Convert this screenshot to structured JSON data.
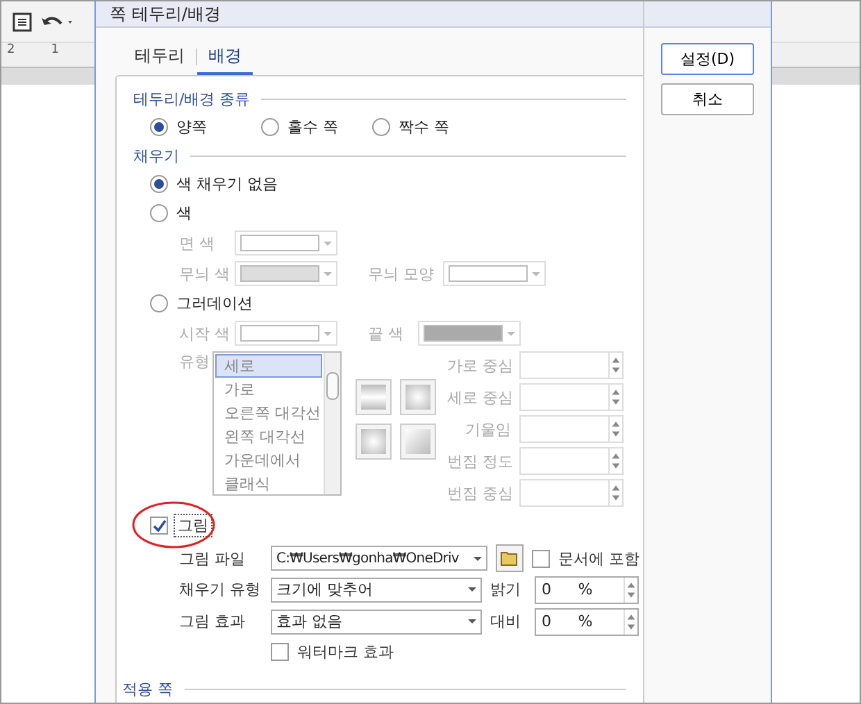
{
  "editor": {
    "ruler_labels": [
      "2",
      "1"
    ]
  },
  "dialog": {
    "title": "쪽 테두리/배경",
    "tabs": [
      {
        "label": "테두리",
        "selected": false
      },
      {
        "label": "배경",
        "selected": true
      }
    ],
    "kind_section": {
      "title": "테두리/배경 종류",
      "options": [
        {
          "label": "양쪽",
          "selected": true
        },
        {
          "label": "홀수 쪽",
          "selected": false
        },
        {
          "label": "짝수 쪽",
          "selected": false
        }
      ]
    },
    "fill_section": {
      "title": "채우기",
      "no_fill": {
        "label": "색 채우기 없음",
        "selected": true
      },
      "color": {
        "label": "색",
        "selected": false,
        "face_label": "면 색",
        "pattern_color_label": "무늬 색",
        "pattern_shape_label": "무늬 모양"
      },
      "gradient": {
        "label": "그러데이션",
        "selected": false,
        "start_label": "시작 색",
        "end_label": "끝 색",
        "type_label": "유형",
        "types": [
          {
            "label": "세로",
            "selected": true
          },
          {
            "label": "가로",
            "selected": false
          },
          {
            "label": "오른쪽 대각선",
            "selected": false
          },
          {
            "label": "왼쪽 대각선",
            "selected": false
          },
          {
            "label": "가운데에서",
            "selected": false
          },
          {
            "label": "클래식",
            "selected": false
          }
        ],
        "spinners": [
          "가로 중심",
          "세로 중심",
          "기울임",
          "번짐 정도",
          "번짐 중심"
        ]
      },
      "picture": {
        "label": "그림",
        "checked": true,
        "file_label": "그림 파일",
        "file_value": "C:₩Users₩gonha₩OneDriv",
        "embed": {
          "label": "문서에 포함",
          "checked": false
        },
        "rows": [
          {
            "label": "채우기 유형",
            "value": "크기에 맞추어",
            "spin_label": "밝기",
            "spin_value": "0",
            "unit": "%"
          },
          {
            "label": "그림 효과",
            "value": "효과 없음",
            "spin_label": "대비",
            "spin_value": "0",
            "unit": "%"
          }
        ],
        "watermark": {
          "label": "워터마크 효과",
          "checked": false
        }
      }
    },
    "apply_section": {
      "title": "적용 쪽"
    },
    "buttons": [
      {
        "label": "설정(D)",
        "default": true
      },
      {
        "label": "취소",
        "default": false
      }
    ]
  }
}
